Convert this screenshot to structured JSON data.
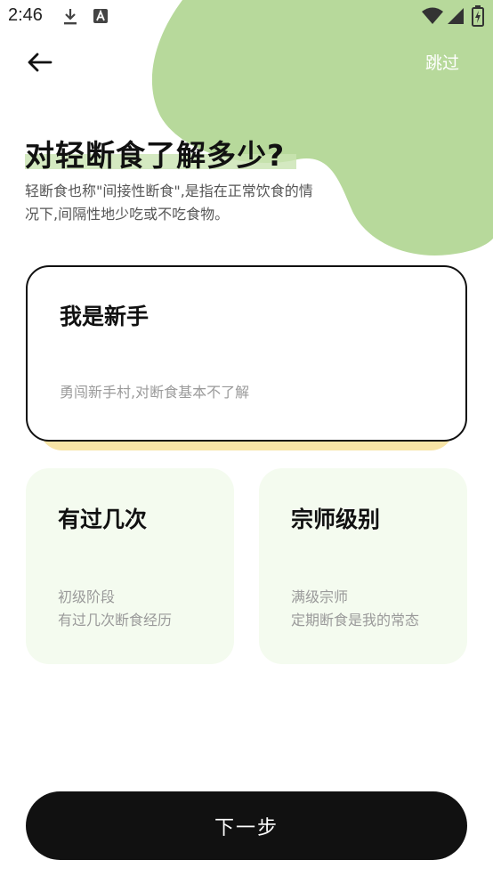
{
  "status_bar": {
    "time": "2:46",
    "icons": [
      "download-icon",
      "a-letter-icon",
      "wifi-icon",
      "signal-icon",
      "battery-icon"
    ]
  },
  "header": {
    "back_icon": "arrow-left-icon",
    "skip_label": "跳过"
  },
  "intro": {
    "title": "对轻断食了解多少?",
    "subtitle": "轻断食也称\"间接性断食\",是指在正常饮食的情况下,间隔性地少吃或不吃食物。"
  },
  "options": [
    {
      "title": "我是新手",
      "desc_lines": [
        "勇闯新手村,对断食基本不了解"
      ],
      "selected": true
    },
    {
      "title": "有过几次",
      "desc_lines": [
        "初级阶段",
        "有过几次断食经历"
      ],
      "selected": false
    },
    {
      "title": "宗师级别",
      "desc_lines": [
        "满级宗师",
        "定期断食是我的常态"
      ],
      "selected": false
    }
  ],
  "footer": {
    "next_label": "下一步"
  },
  "colors": {
    "blob": "#b7d99b",
    "highlight": "#c9e4b1",
    "selected_shadow": "#f7e4a6",
    "card_bg": "#f4fbef",
    "button_bg": "#111111"
  }
}
